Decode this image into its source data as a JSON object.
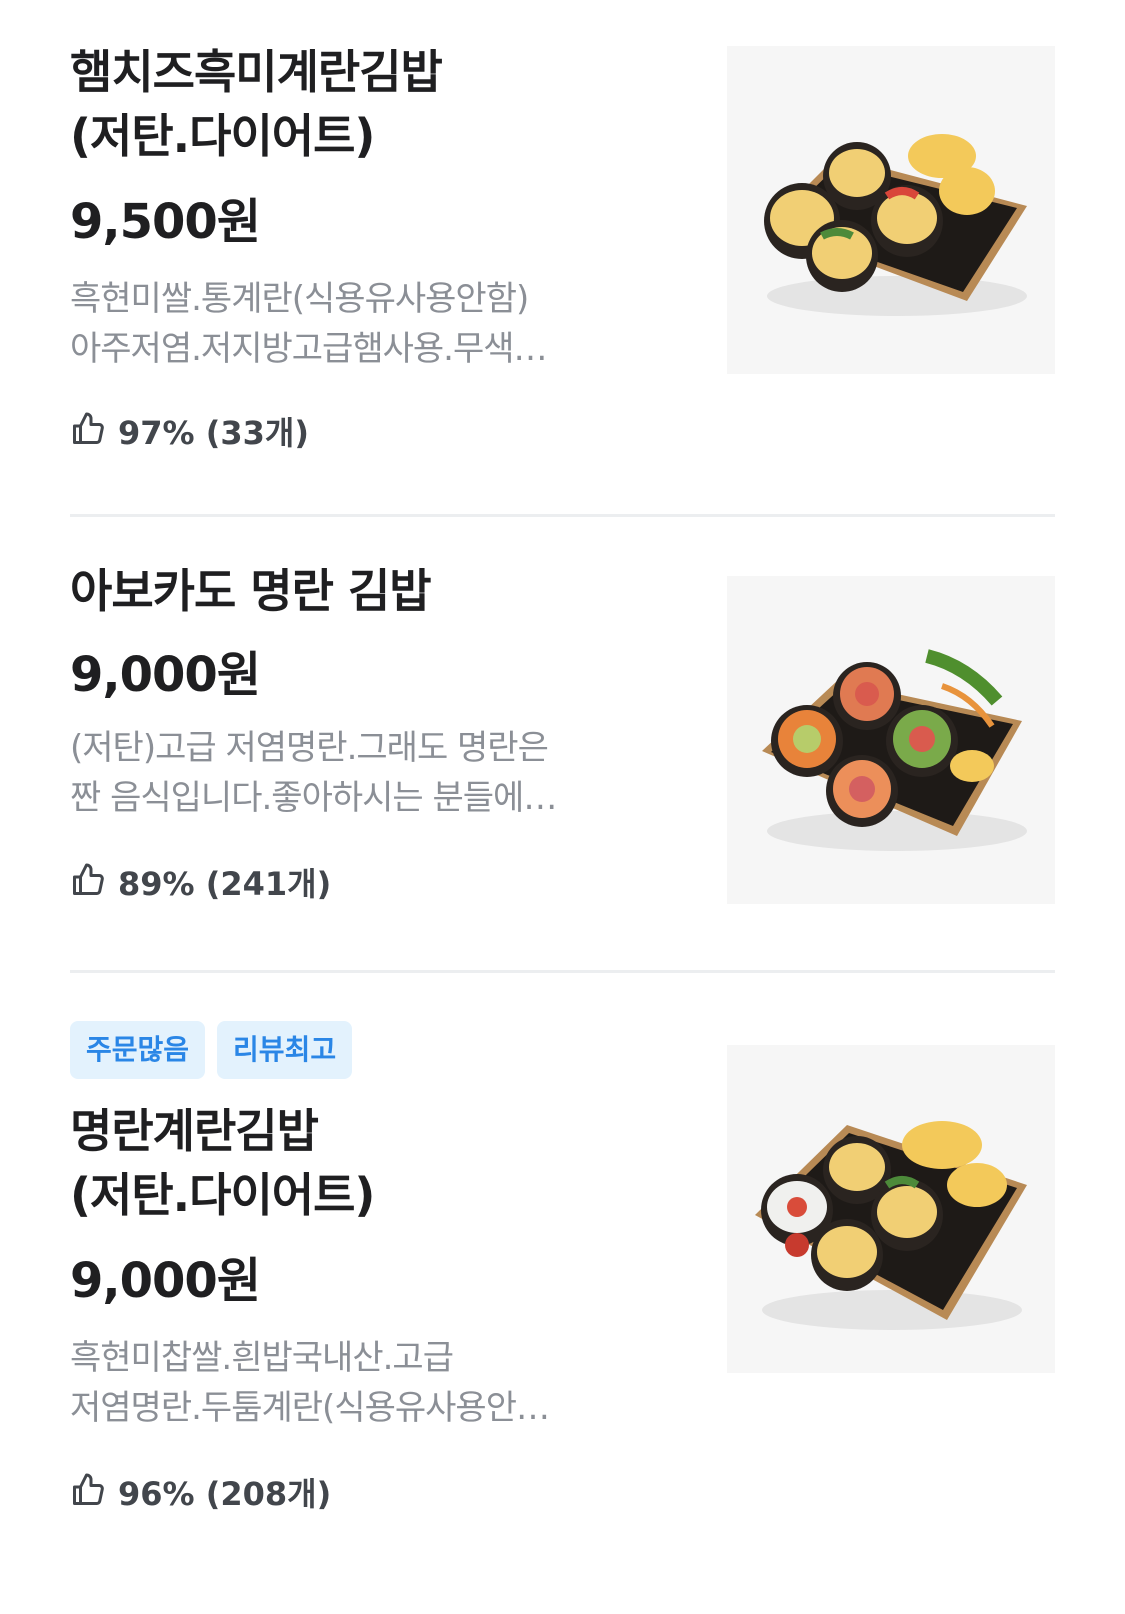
{
  "items": [
    {
      "title": "햄치즈흑미계란김밥\n(저탄.다이어트)",
      "price": "9,500원",
      "desc_line1": "흑현미쌀.통계란(식용유사용안함)",
      "desc_line2": "아주저염.저지방고급햄사용.무색…",
      "rating": "97% (33개)"
    },
    {
      "title": "아보카도 명란 김밥",
      "price": "9,000원",
      "desc_line1": "(저탄)고급 저염명란.그래도 명란은",
      "desc_line2": "짠 음식입니다.좋아하시는 분들에…",
      "rating": "89% (241개)"
    },
    {
      "badges": [
        "주문많음",
        "리뷰최고"
      ],
      "title": "명란계란김밥\n(저탄.다이어트)",
      "price": "9,000원",
      "desc_line1": "흑현미찹쌀.흰밥국내산.고급",
      "desc_line2": "저염명란.두툼계란(식용유사용안…",
      "rating": "96% (208개)"
    }
  ]
}
